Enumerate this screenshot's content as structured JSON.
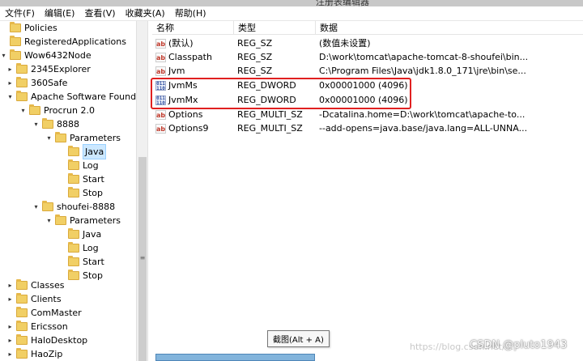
{
  "window": {
    "title": "注册表编辑器"
  },
  "menu": [
    {
      "label": "文件(F)"
    },
    {
      "label": "编辑(E)"
    },
    {
      "label": "查看(V)"
    },
    {
      "label": "收藏夹(A)"
    },
    {
      "label": "帮助(H)"
    }
  ],
  "tree": {
    "items": [
      {
        "label": "Policies",
        "toggle": ""
      },
      {
        "label": "RegisteredApplications",
        "toggle": ""
      },
      {
        "label": "Wow6432Node",
        "toggle": "▾"
      },
      {
        "label": "2345Explorer",
        "toggle": "▸"
      },
      {
        "label": "360Safe",
        "toggle": "▸"
      },
      {
        "label": "Apache Software Foundatio",
        "toggle": "▾"
      },
      {
        "label": "Procrun 2.0",
        "toggle": "▾"
      },
      {
        "label": "8888",
        "toggle": "▾"
      },
      {
        "label": "Parameters",
        "toggle": "▾"
      },
      {
        "label": "Java",
        "toggle": ""
      },
      {
        "label": "Log",
        "toggle": ""
      },
      {
        "label": "Start",
        "toggle": ""
      },
      {
        "label": "Stop",
        "toggle": ""
      },
      {
        "label": "shoufei-8888",
        "toggle": "▾"
      },
      {
        "label": "Parameters",
        "toggle": "▾"
      },
      {
        "label": "Java",
        "toggle": ""
      },
      {
        "label": "Log",
        "toggle": ""
      },
      {
        "label": "Start",
        "toggle": ""
      },
      {
        "label": "Stop",
        "toggle": ""
      },
      {
        "label": "Classes",
        "toggle": "▸"
      },
      {
        "label": "Clients",
        "toggle": "▸"
      },
      {
        "label": "ComMaster",
        "toggle": ""
      },
      {
        "label": "Ericsson",
        "toggle": "▸"
      },
      {
        "label": "HaloDesktop",
        "toggle": "▸"
      },
      {
        "label": "HaoZip",
        "toggle": "▸"
      }
    ],
    "selected": "Java"
  },
  "list": {
    "columns": {
      "name": "名称",
      "type": "类型",
      "data": "数据"
    },
    "rows": [
      {
        "icon": "ab",
        "name": "(默认)",
        "type": "REG_SZ",
        "data": "(数值未设置)"
      },
      {
        "icon": "ab",
        "name": "Classpath",
        "type": "REG_SZ",
        "data": "D:\\work\\tomcat\\apache-tomcat-8-shoufei\\bin..."
      },
      {
        "icon": "ab",
        "name": "Jvm",
        "type": "REG_SZ",
        "data": "C:\\Program Files\\Java\\jdk1.8.0_171\\jre\\bin\\se..."
      },
      {
        "icon": "bin",
        "name": "JvmMs",
        "type": "REG_DWORD",
        "data": "0x00001000 (4096)"
      },
      {
        "icon": "bin",
        "name": "JvmMx",
        "type": "REG_DWORD",
        "data": "0x00001000 (4096)"
      },
      {
        "icon": "ab",
        "name": "Options",
        "type": "REG_MULTI_SZ",
        "data": "-Dcatalina.home=D:\\work\\tomcat\\apache-to..."
      },
      {
        "icon": "ab",
        "name": "Options9",
        "type": "REG_MULTI_SZ",
        "data": "--add-opens=java.base/java.lang=ALL-UNNA..."
      }
    ]
  },
  "icon_text": {
    "ab": "ab",
    "bin": "011\n110"
  },
  "tooltip": "截图(Alt + A)",
  "watermark": {
    "main": "CSDN @pluto1943",
    "faint": "https://blog.csdn.net/..."
  },
  "colors": {
    "highlight": "#e02020",
    "selection": "#cce8ff",
    "folder": "#f1cf65"
  }
}
